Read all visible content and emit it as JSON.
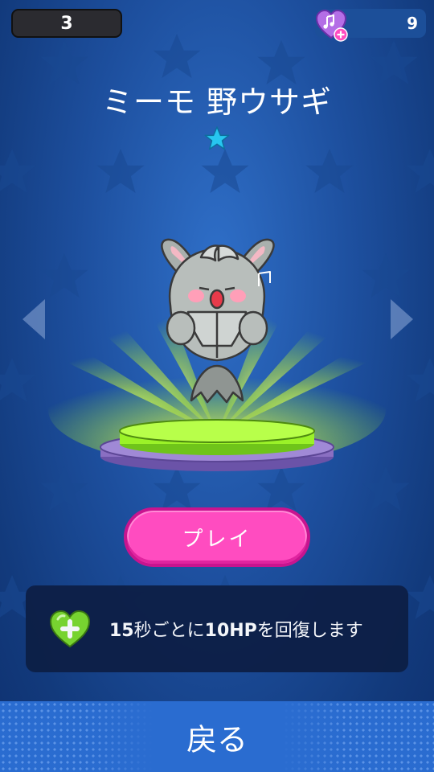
{
  "header": {
    "level": "3",
    "hearts": "9"
  },
  "character": {
    "name": "ミーモ 野ウサギ",
    "rank_stars": 1
  },
  "buttons": {
    "play": "プレイ",
    "back": "戻る"
  },
  "info": {
    "seconds": "15",
    "part1": "秒ごとに",
    "hp": "10HP",
    "part2": "を回復します"
  },
  "colors": {
    "play_button": "#ff4cc0",
    "platform_top": "#9bf228",
    "platform_base": "#8a6fc2",
    "rank_star": "#27c6f0",
    "info_heart": "#7ddc2c"
  }
}
